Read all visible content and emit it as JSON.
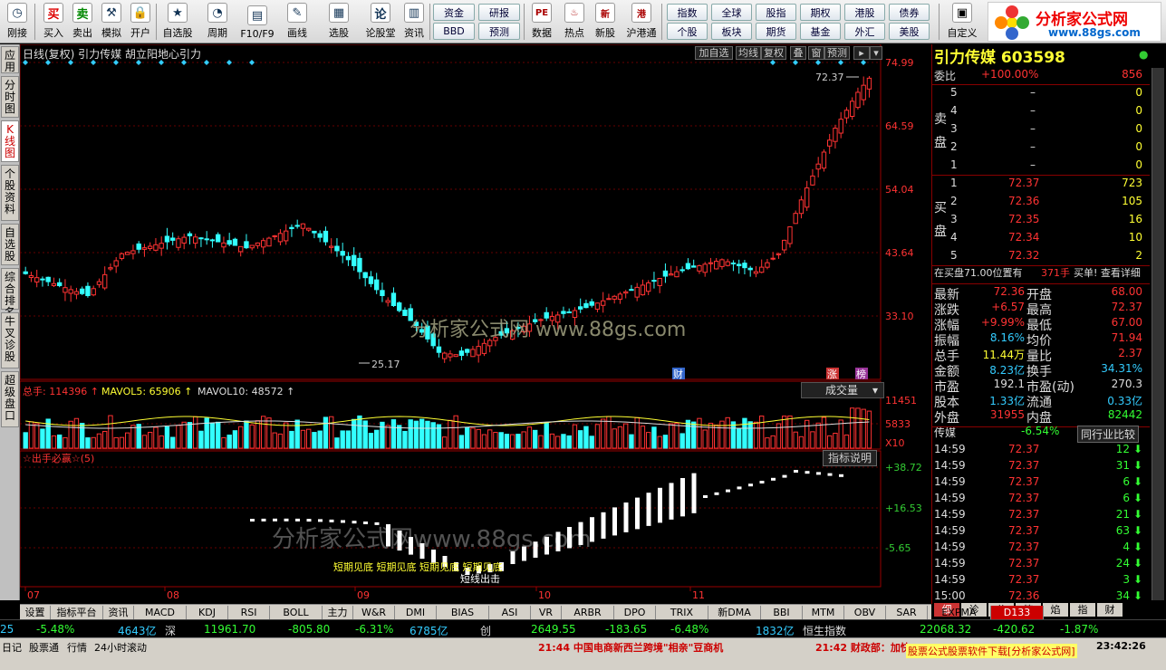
{
  "toolbar": {
    "buttons": [
      {
        "label": "刚接",
        "icon": "clock-icon"
      },
      {
        "label": "买入",
        "icon": "buy-icon"
      },
      {
        "label": "卖出",
        "icon": "sell-icon"
      },
      {
        "label": "模拟",
        "icon": "hammer-icon"
      },
      {
        "label": "开户",
        "icon": "lock-icon"
      },
      {
        "label": "自选股",
        "icon": "star-icon"
      },
      {
        "label": "周期",
        "icon": "cycle-icon"
      },
      {
        "label": "F10/F9",
        "icon": "f10-icon"
      },
      {
        "label": "画线",
        "icon": "pen-icon"
      },
      {
        "label": "选股",
        "icon": "select-icon"
      },
      {
        "label": "论股堂",
        "icon": "forum-icon"
      },
      {
        "label": "资讯",
        "icon": "news-icon"
      }
    ],
    "grid1": [
      "资金",
      "研报",
      "BBD",
      "预测"
    ],
    "mid_buttons": [
      {
        "label": "数据",
        "icon": "pe-icon"
      },
      {
        "label": "热点",
        "icon": "hot-icon"
      },
      {
        "label": "新股",
        "icon": "newstock-icon"
      },
      {
        "label": "沪港通",
        "icon": "hk-icon"
      }
    ],
    "grid2": [
      "指数",
      "全球",
      "股指",
      "期权",
      "港股",
      "债券",
      "个股",
      "板块",
      "期货",
      "基金",
      "外汇",
      "美股"
    ],
    "custom": "自定义"
  },
  "logo": {
    "title": "分析家公式网",
    "url": "www.88gs.com"
  },
  "left_tabs": [
    "应用",
    "分时图",
    "K线图",
    "个股资料",
    "自选股",
    "综合排名",
    "牛叉诊股",
    "超级盘口"
  ],
  "chart": {
    "header": "日线(复权)  引力传媒  胡立阳地心引力",
    "tools": [
      "加自选",
      "均线",
      "复权",
      "叠",
      "窗",
      "预测"
    ],
    "price_axis": [
      "74.99",
      "64.59",
      "54.04",
      "43.64",
      "33.10"
    ],
    "high_label": "72.37",
    "low_label": "25.17",
    "watermark1": "分析家公式网 www.88gs.com",
    "watermark2": "分析家公式网www.88gs.com",
    "badges": [
      "财",
      "涨",
      "榜"
    ],
    "vol_header": {
      "total": "总手: 114396",
      "mavol5": "MAVOL5: 65906",
      "mavol10": "MAVOL10: 48572"
    },
    "vol_select": "成交量",
    "vol_axis": [
      "11451",
      "5833",
      "X10"
    ],
    "ind_name": "☆出手必赢☆(5)",
    "ind_button": "指标说明",
    "ind_axis": [
      "+38.72",
      "+16.53",
      "-5.65"
    ],
    "ind_labels": [
      "短期见底 短期见底 短期见底 短期见底",
      "短线出击"
    ],
    "date_axis": [
      "07",
      "08",
      "09",
      "10",
      "11"
    ]
  },
  "chart_data": {
    "type": "candlestick",
    "x": [
      "07",
      "08",
      "09",
      "10",
      "11"
    ],
    "ylim": [
      25.17,
      74.99
    ],
    "last_close": 72.36
  },
  "quote": {
    "name": "引力传媒 603598",
    "weibi_label": "委比",
    "weibi": "+100.00%",
    "weibi_num": "856",
    "sell_label": "卖盘",
    "buy_label": "买盘",
    "asks": [
      {
        "lv": "5",
        "p": "–",
        "v": "0"
      },
      {
        "lv": "4",
        "p": "–",
        "v": "0"
      },
      {
        "lv": "3",
        "p": "–",
        "v": "0"
      },
      {
        "lv": "2",
        "p": "–",
        "v": "0"
      },
      {
        "lv": "1",
        "p": "–",
        "v": "0"
      }
    ],
    "bids": [
      {
        "lv": "1",
        "p": "72.37",
        "v": "723"
      },
      {
        "lv": "2",
        "p": "72.36",
        "v": "105"
      },
      {
        "lv": "3",
        "p": "72.35",
        "v": "16"
      },
      {
        "lv": "4",
        "p": "72.34",
        "v": "10"
      },
      {
        "lv": "5",
        "p": "72.32",
        "v": "2"
      }
    ],
    "note": "在买盘71.00位置有",
    "note_num": "371手",
    "note_link": "买单! 查看详细",
    "stats": [
      {
        "l1": "最新",
        "v1": "72.36",
        "l2": "开盘",
        "v2": "68.00",
        "c1": "#f33",
        "c2": "#f33"
      },
      {
        "l1": "涨跌",
        "v1": "+6.57",
        "l2": "最高",
        "v2": "72.37",
        "c1": "#f33",
        "c2": "#f33"
      },
      {
        "l1": "涨幅",
        "v1": "+9.99%",
        "l2": "最低",
        "v2": "67.00",
        "c1": "#f33",
        "c2": "#f33"
      },
      {
        "l1": "振幅",
        "v1": "8.16%",
        "l2": "均价",
        "v2": "71.94",
        "c1": "#3cf",
        "c2": "#f33"
      },
      {
        "l1": "总手",
        "v1": "11.44万",
        "l2": "量比",
        "v2": "2.37",
        "c1": "#ff3",
        "c2": "#f33"
      },
      {
        "l1": "金额",
        "v1": "8.23亿",
        "l2": "换手",
        "v2": "34.31%",
        "c1": "#3cf",
        "c2": "#3cf"
      },
      {
        "l1": "市盈",
        "v1": "192.1",
        "l2": "市盈(动)",
        "v2": "270.3",
        "c1": "#ddd",
        "c2": "#ddd"
      },
      {
        "l1": "股本",
        "v1": "1.33亿",
        "l2": "流通",
        "v2": "0.33亿",
        "c1": "#3cf",
        "c2": "#3cf"
      },
      {
        "l1": "外盘",
        "v1": "31955",
        "l2": "内盘",
        "v2": "82442",
        "c1": "#f33",
        "c2": "#3f3"
      }
    ],
    "industry": "传媒",
    "industry_pct": "-6.54%",
    "industry_btn": "同行业比较",
    "ticks": [
      {
        "t": "14:59",
        "p": "72.37",
        "v": "12"
      },
      {
        "t": "14:59",
        "p": "72.37",
        "v": "31"
      },
      {
        "t": "14:59",
        "p": "72.37",
        "v": "6"
      },
      {
        "t": "14:59",
        "p": "72.37",
        "v": "6"
      },
      {
        "t": "14:59",
        "p": "72.37",
        "v": "21"
      },
      {
        "t": "14:59",
        "p": "72.37",
        "v": "63"
      },
      {
        "t": "14:59",
        "p": "72.37",
        "v": "4"
      },
      {
        "t": "14:59",
        "p": "72.37",
        "v": "24"
      },
      {
        "t": "14:59",
        "p": "72.37",
        "v": "3"
      },
      {
        "t": "15:00",
        "p": "72.36",
        "v": "34"
      }
    ],
    "bottom_tabs": [
      "细",
      "诊",
      "分",
      "筹",
      "焰",
      "指",
      "财"
    ]
  },
  "bottom_tabs": [
    "设置",
    "指标平台",
    "资讯",
    "MACD",
    "KDJ",
    "RSI",
    "BOLL",
    "主力",
    "W&R",
    "DMI",
    "BIAS",
    "ASI",
    "VR",
    "ARBR",
    "DPO",
    "TRIX",
    "新DMA",
    "BBI",
    "MTM",
    "OBV",
    "SAR",
    "EXPMA",
    "D133"
  ],
  "ticker": [
    {
      "t": "25",
      "c": "#3cf"
    },
    {
      "t": "-5.48%",
      "c": "#3f3"
    },
    {
      "t": "4643亿",
      "c": "#3cf"
    },
    {
      "t": "深",
      "c": "#ddd"
    },
    {
      "t": "11961.70",
      "c": "#3f3"
    },
    {
      "t": "-805.80",
      "c": "#3f3"
    },
    {
      "t": "-6.31%",
      "c": "#3f3"
    },
    {
      "t": "6785亿",
      "c": "#3cf"
    },
    {
      "t": "创",
      "c": "#ddd"
    },
    {
      "t": "2649.55",
      "c": "#3f3"
    },
    {
      "t": "-183.65",
      "c": "#3f3"
    },
    {
      "t": "-6.48%",
      "c": "#3f3"
    },
    {
      "t": "1832亿",
      "c": "#3cf"
    },
    {
      "t": "恒生指数",
      "c": "#ddd"
    },
    {
      "t": "22068.32",
      "c": "#3f3"
    },
    {
      "t": "-420.62",
      "c": "#3f3"
    },
    {
      "t": "-1.87%",
      "c": "#3f3"
    }
  ],
  "status": {
    "items": [
      "日记",
      "股票通",
      "行情",
      "24小时滚动"
    ],
    "news1": "21:44 中国电商新西兰跨境\"相亲\"豆商机",
    "news2": "21:42 财政部：加快",
    "footer": "股票公式股票软件下载[分析家公式网]",
    "time": "23:42:26"
  }
}
